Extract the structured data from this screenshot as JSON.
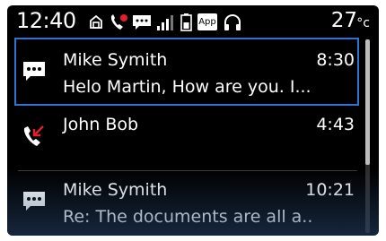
{
  "status_bar": {
    "time": "12:40",
    "temperature": "27",
    "temperature_unit": "°c",
    "icons": [
      "car-connect-icon",
      "missed-call-icon",
      "message-icon",
      "signal-icon",
      "battery-icon",
      "app-icon",
      "headset-icon"
    ],
    "app_badge": "App"
  },
  "list": {
    "items": [
      {
        "type": "message",
        "icon": "message-icon",
        "name": "Mike Symith",
        "time": "8:30",
        "preview": "Helo Martin, How are you. I..."
      },
      {
        "type": "missed-call",
        "icon": "missed-call-icon",
        "name": "John Bob",
        "time": "4:43",
        "preview": ""
      },
      {
        "type": "message",
        "icon": "message-icon",
        "name": "Mike Symith",
        "time": "10:21",
        "preview": "Re: The documents are all a.."
      }
    ],
    "selected_index": 0
  },
  "colors": {
    "selection": "#2f73d8",
    "missed_call": "#e0202a",
    "background": "#000000",
    "text": "#ffffff"
  }
}
